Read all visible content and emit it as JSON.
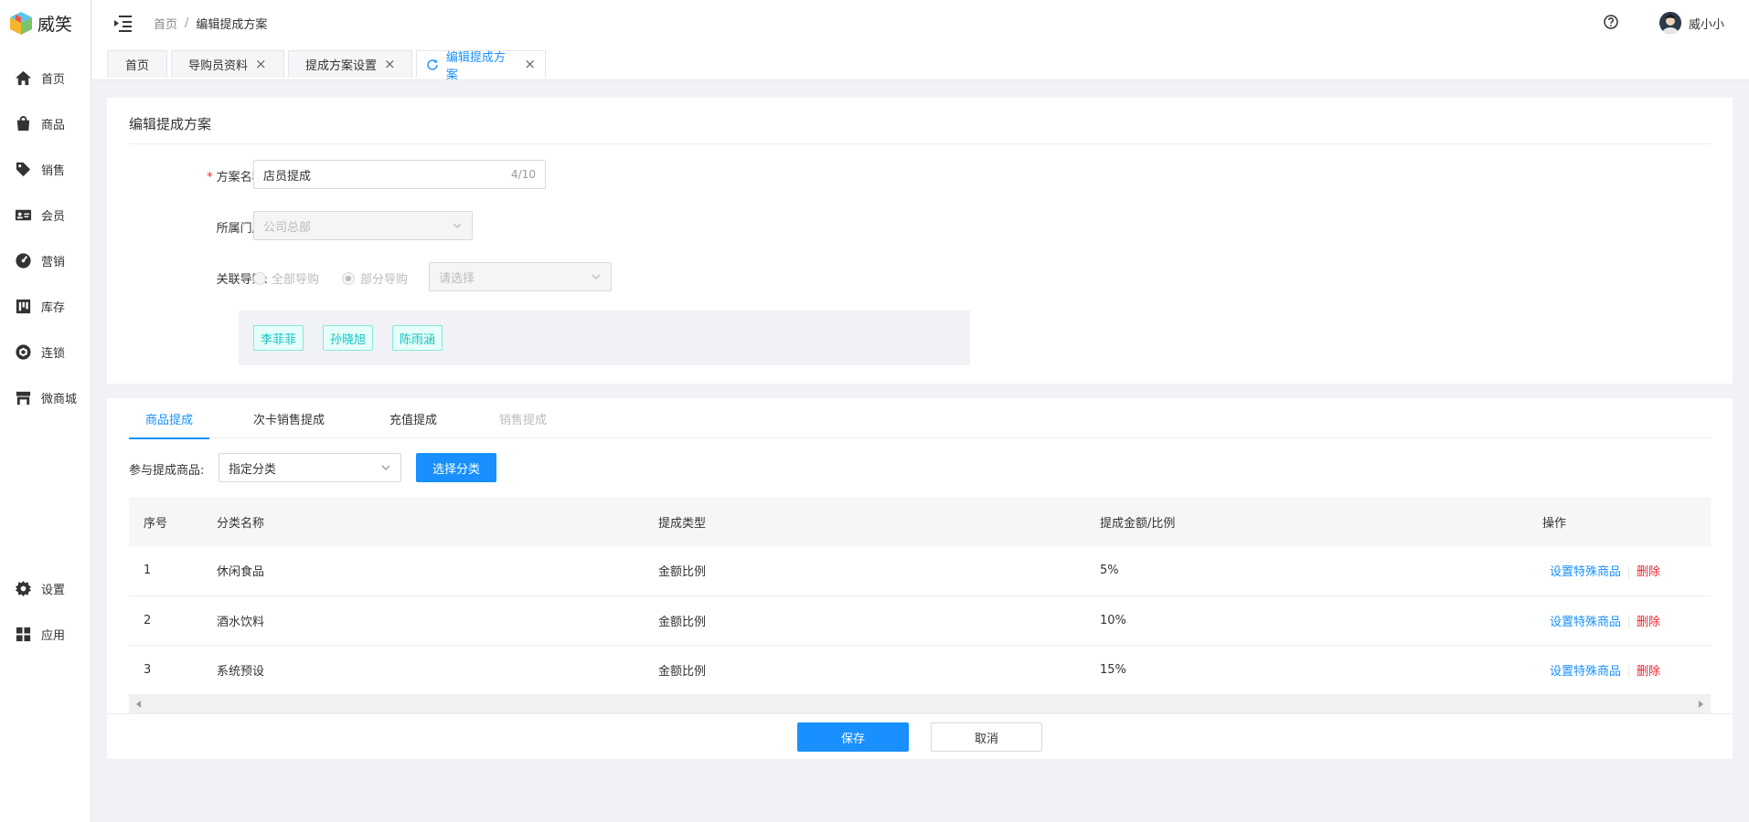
{
  "brand": {
    "name": "威笑"
  },
  "sidebar": {
    "items": [
      {
        "label": "首页",
        "icon": "home-icon"
      },
      {
        "label": "商品",
        "icon": "bag-icon"
      },
      {
        "label": "销售",
        "icon": "tag-icon"
      },
      {
        "label": "会员",
        "icon": "member-card-icon"
      },
      {
        "label": "营销",
        "icon": "dashboard-icon"
      },
      {
        "label": "库存",
        "icon": "inventory-icon"
      },
      {
        "label": "连锁",
        "icon": "chain-icon"
      },
      {
        "label": "微商城",
        "icon": "store-icon"
      }
    ],
    "bottom_items": [
      {
        "label": "设置",
        "icon": "gear-icon"
      },
      {
        "label": "应用",
        "icon": "apps-grid-icon"
      }
    ]
  },
  "header": {
    "breadcrumb": [
      "首页",
      "编辑提成方案"
    ],
    "user_name": "威小小"
  },
  "tabs": [
    {
      "label": "首页",
      "closable": false
    },
    {
      "label": "导购员资料",
      "closable": true
    },
    {
      "label": "提成方案设置",
      "closable": true
    },
    {
      "label": "编辑提成方案",
      "closable": true,
      "active": true
    }
  ],
  "form": {
    "title": "编辑提成方案",
    "plan_name": {
      "label": "方案名称:",
      "value": "店员提成",
      "count": "4/10"
    },
    "store": {
      "label": "所属门店:",
      "value": "公司总部"
    },
    "guide": {
      "label": "关联导购:",
      "option_all": "全部导购",
      "option_partial": "部分导购",
      "selected": "部分导购",
      "select_placeholder": "请选择"
    },
    "selected_guides": [
      "李菲菲",
      "孙晓旭",
      "陈雨涵"
    ]
  },
  "commission": {
    "tabs": [
      {
        "label": "商品提成",
        "state": "active"
      },
      {
        "label": "次卡销售提成",
        "state": "normal"
      },
      {
        "label": "充值提成",
        "state": "normal"
      },
      {
        "label": "销售提成",
        "state": "disabled"
      }
    ],
    "goods_label": "参与提成商品:",
    "goods_select": "指定分类",
    "select_button": "选择分类",
    "columns": [
      "序号",
      "分类名称",
      "提成类型",
      "提成金额/比例",
      "操作"
    ],
    "rows": [
      {
        "no": "1",
        "name": "休闲食品",
        "type": "金额比例",
        "rate": "5%"
      },
      {
        "no": "2",
        "name": "酒水饮料",
        "type": "金额比例",
        "rate": "10%"
      },
      {
        "no": "3",
        "name": "系统预设",
        "type": "金额比例",
        "rate": "15%"
      }
    ],
    "op_special": "设置特殊商品",
    "op_delete": "删除"
  },
  "footer": {
    "save": "保存",
    "cancel": "取消"
  },
  "colors": {
    "primary": "#1890ff",
    "danger": "#f5222d",
    "tag": "#13c2c2"
  }
}
